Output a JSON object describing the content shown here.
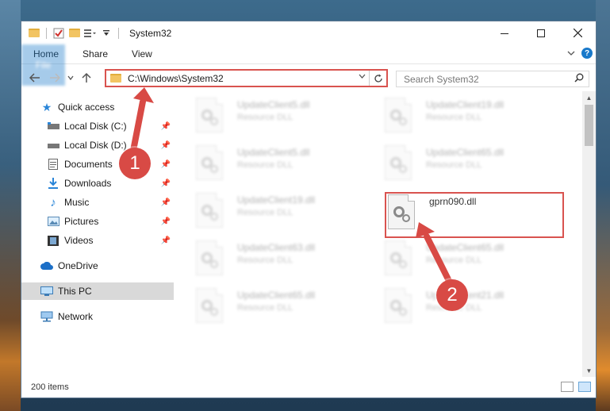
{
  "window": {
    "title": "System32"
  },
  "ribbon": {
    "tabs": [
      "File",
      "Home",
      "Share",
      "View"
    ]
  },
  "nav": {
    "address": "C:\\Windows\\System32",
    "search_placeholder": "Search System32"
  },
  "sidebar": {
    "items": [
      {
        "label": "Quick access",
        "icon": "star-icon"
      },
      {
        "label": "Local Disk (C:)",
        "icon": "drive-icon",
        "pinned": true
      },
      {
        "label": "Local Disk (D:)",
        "icon": "drive-icon",
        "pinned": true
      },
      {
        "label": "Documents",
        "icon": "documents-icon",
        "pinned": true
      },
      {
        "label": "Downloads",
        "icon": "download-icon",
        "pinned": true
      },
      {
        "label": "Music",
        "icon": "music-icon",
        "pinned": true
      },
      {
        "label": "Pictures",
        "icon": "pictures-icon",
        "pinned": true
      },
      {
        "label": "Videos",
        "icon": "videos-icon",
        "pinned": true
      },
      {
        "label": "OneDrive",
        "icon": "cloud-icon"
      },
      {
        "label": "This PC",
        "icon": "computer-icon",
        "selected": true
      },
      {
        "label": "Network",
        "icon": "network-icon"
      }
    ]
  },
  "files": [
    {
      "name": "UpdateClient5.dll",
      "type": "Resource DLL"
    },
    {
      "name": "UpdateClient19.dll",
      "type": "Resource DLL"
    },
    {
      "name": "UpdateClient5.dll",
      "type": "Resource DLL"
    },
    {
      "name": "UpdateClient65.dll",
      "type": "Resource DLL"
    },
    {
      "name": "UpdateClient19.dll",
      "type": "Resource DLL"
    },
    {
      "name": "gprn090.dll",
      "type": ""
    },
    {
      "name": "UpdateClient63.dll",
      "type": "Resource DLL"
    },
    {
      "name": "UpdateClient65.dll",
      "type": "Resource DLL"
    },
    {
      "name": "UpdateClient65.dll",
      "type": "Resource DLL"
    },
    {
      "name": "UpdateClient21.dll",
      "type": "Resource DLL"
    }
  ],
  "status": {
    "item_count": "200 items"
  },
  "callouts": [
    "1",
    "2"
  ],
  "colors": {
    "accent": "#1979ca",
    "highlight": "#d9534f"
  }
}
